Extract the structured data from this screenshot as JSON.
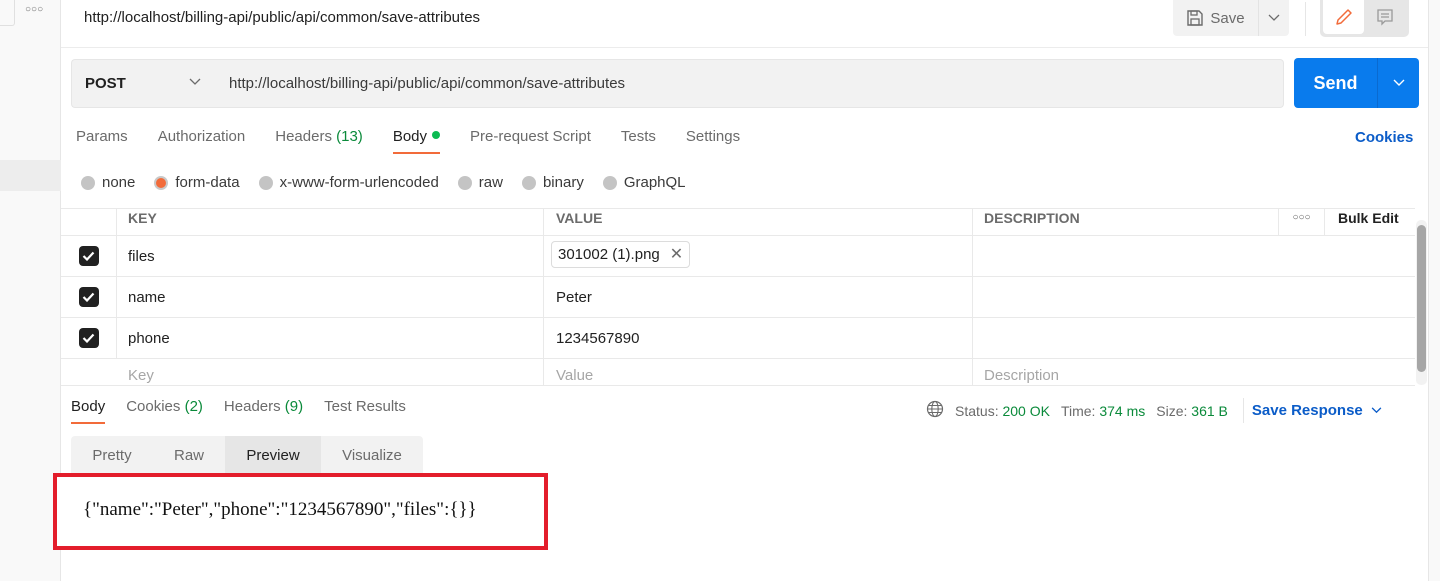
{
  "header": {
    "title": "http://localhost/billing-api/public/api/common/save-attributes",
    "save_label": "Save",
    "sidebar_more_icon": "ellipsis-icon"
  },
  "request": {
    "method": "POST",
    "url": "http://localhost/billing-api/public/api/common/save-attributes",
    "send_label": "Send",
    "tabs": [
      {
        "label": "Params",
        "count": ""
      },
      {
        "label": "Authorization",
        "count": ""
      },
      {
        "label": "Headers",
        "count": "(13)"
      },
      {
        "label": "Body",
        "count": ""
      },
      {
        "label": "Pre-request Script",
        "count": ""
      },
      {
        "label": "Tests",
        "count": ""
      },
      {
        "label": "Settings",
        "count": ""
      }
    ],
    "active_tab": "Body",
    "cookies_label": "Cookies",
    "body_types": [
      "none",
      "form-data",
      "x-www-form-urlencoded",
      "raw",
      "binary",
      "GraphQL"
    ],
    "selected_body_type": "form-data"
  },
  "form_table": {
    "headers": {
      "key": "KEY",
      "value": "VALUE",
      "description": "DESCRIPTION",
      "bulk_edit": "Bulk Edit"
    },
    "rows": [
      {
        "checked": true,
        "key": "files",
        "value": "301002 (1).png",
        "type": "file",
        "description": ""
      },
      {
        "checked": true,
        "key": "name",
        "value": "Peter",
        "type": "text",
        "description": ""
      },
      {
        "checked": true,
        "key": "phone",
        "value": "1234567890",
        "type": "text",
        "description": ""
      }
    ],
    "placeholders": {
      "key": "Key",
      "value": "Value",
      "description": "Description"
    }
  },
  "response": {
    "tabs": [
      {
        "label": "Body",
        "count": ""
      },
      {
        "label": "Cookies",
        "count": "(2)"
      },
      {
        "label": "Headers",
        "count": "(9)"
      },
      {
        "label": "Test Results",
        "count": ""
      }
    ],
    "active_tab": "Body",
    "status_label": "Status:",
    "status_value": "200 OK",
    "time_label": "Time:",
    "time_value": "374 ms",
    "size_label": "Size:",
    "size_value": "361 B",
    "save_response_label": "Save Response",
    "view_tabs": [
      "Pretty",
      "Raw",
      "Preview",
      "Visualize"
    ],
    "active_view": "Preview",
    "preview_content": "{\"name\":\"Peter\",\"phone\":\"1234567890\",\"files\":{}}",
    "highlight_color": "#e31d2b"
  },
  "colors": {
    "accent": "#f26b3a",
    "send_button": "#097bed",
    "link": "#0b5cc8",
    "success": "#0a8a3a"
  }
}
